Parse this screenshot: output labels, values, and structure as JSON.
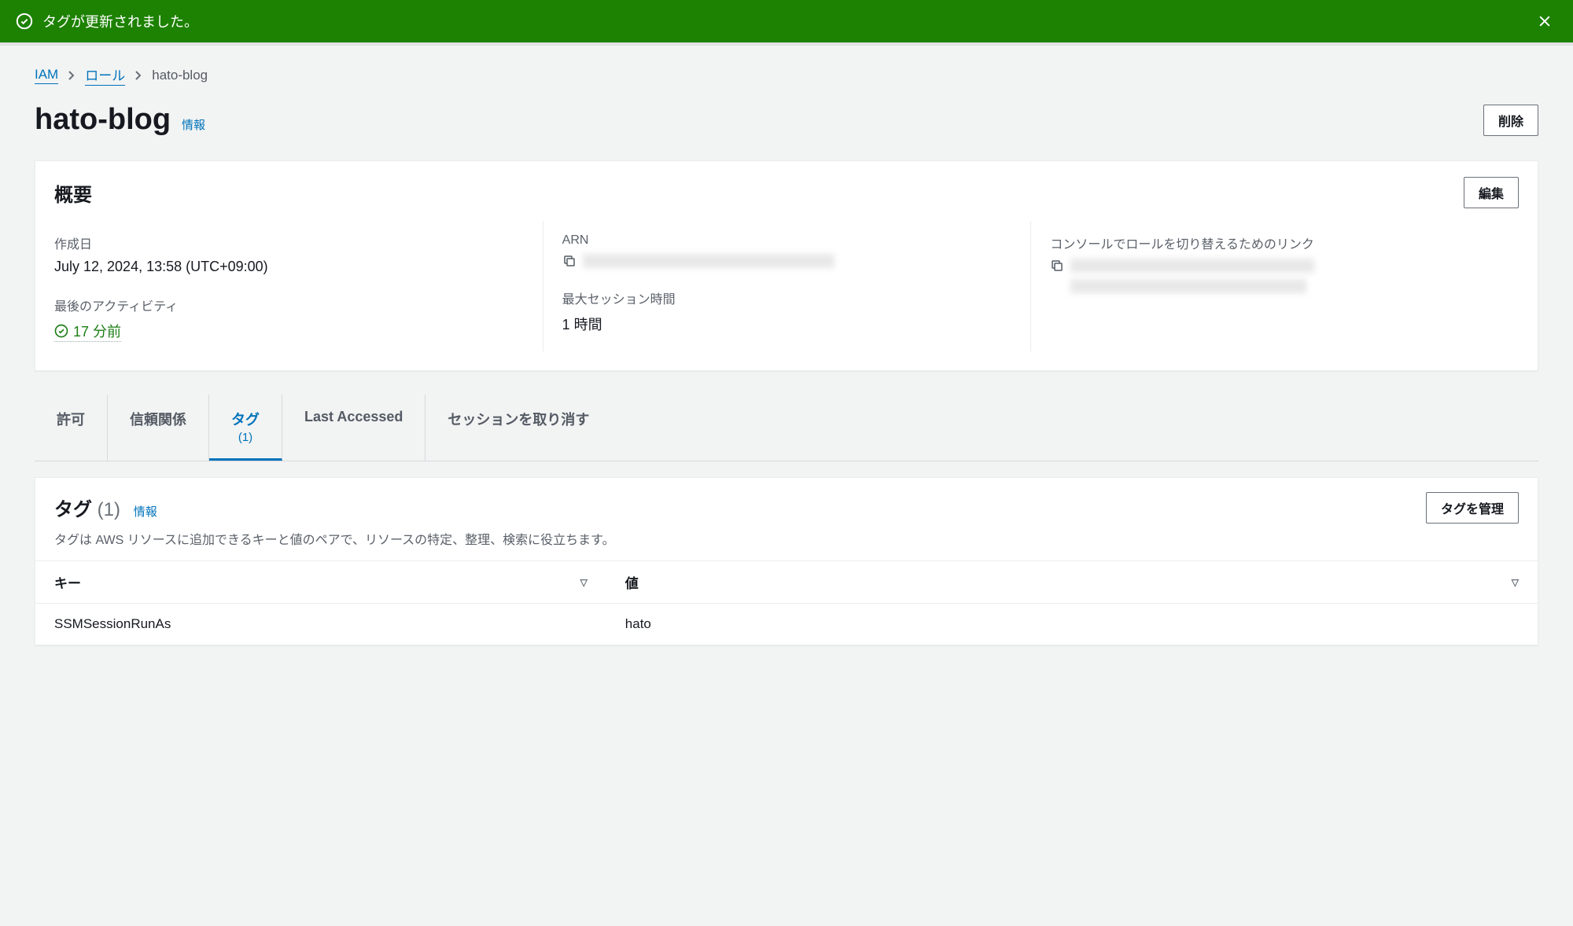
{
  "flash": {
    "message": "タグが更新されました。"
  },
  "breadcrumb": {
    "root": "IAM",
    "parent": "ロール",
    "current": "hato-blog"
  },
  "page_title": "hato-blog",
  "info_label": "情報",
  "buttons": {
    "delete": "削除",
    "edit": "編集",
    "manage_tags": "タグを管理"
  },
  "overview": {
    "title": "概要",
    "created_label": "作成日",
    "created_value": "July 12, 2024, 13:58 (UTC+09:00)",
    "arn_label": "ARN",
    "switch_label": "コンソールでロールを切り替えるためのリンク",
    "last_activity_label": "最後のアクティビティ",
    "last_activity_value": "17 分前",
    "max_session_label": "最大セッション時間",
    "max_session_value": "1 時間"
  },
  "tabs": {
    "permissions": "許可",
    "trust": "信頼関係",
    "tags": "タグ",
    "tags_count": "(1)",
    "last_accessed": "Last Accessed",
    "revoke": "セッションを取り消す"
  },
  "tags_panel": {
    "title": "タグ",
    "count": "(1)",
    "info": "情報",
    "desc": "タグは AWS リソースに追加できるキーと値のペアで、リソースの特定、整理、検索に役立ちます。",
    "col_key": "キー",
    "col_value": "値",
    "rows": [
      {
        "key": "SSMSessionRunAs",
        "value": "hato"
      }
    ]
  }
}
